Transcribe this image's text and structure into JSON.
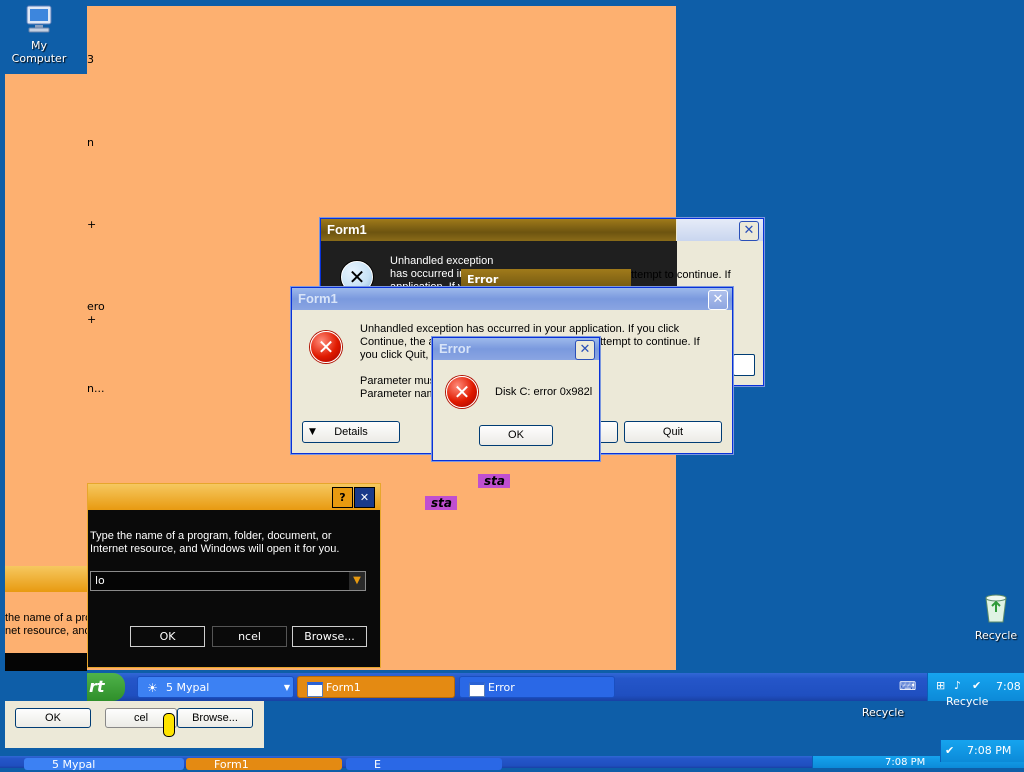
{
  "desktop": {
    "icons": [
      {
        "label": "My Computer",
        "icon": "my-computer-icon"
      },
      {
        "label": "Recycle",
        "icon": "recycle-bin-icon"
      },
      {
        "label": "Recycle",
        "icon": "recycle-bin-icon"
      }
    ],
    "ghost_fragments": [
      "3",
      "n",
      "+",
      "ero",
      "+",
      "n...",
      "sta",
      "sta",
      "Recycle"
    ]
  },
  "form1_back": {
    "title": "Form1",
    "message": "Unhandled exception has occurred in your application. If you click Continue, the a",
    "message_tail": "ttempt to continue. If",
    "inner_title": "Error"
  },
  "form1_front": {
    "title": "Form1",
    "message_line1": "Unhandled exception has occurred in your application. If you click",
    "message_line2a": "Continue, the a",
    "message_line2b": "ttempt to continue. If",
    "message_line3": "you click Quit, t",
    "param_line1": "Parameter must",
    "param_line2": "Parameter nam",
    "details_button": "Details",
    "quit_button": "Quit"
  },
  "error_dialog": {
    "title": "Error",
    "message": "Disk C: error 0x982l",
    "ok_button": "OK"
  },
  "run_dialog": {
    "help_glyph": "?",
    "close_glyph": "✕",
    "prompt_line1": "Type the name of a program, folder, document, or",
    "prompt_line2": "Internet resource, and Windows will open it for you.",
    "input_value": "lo",
    "ok_button": "OK",
    "cancel_button": "ncel",
    "browse_button": "Browse..."
  },
  "run_dialog_ghost": {
    "prompt_line1": "the name of a pro",
    "prompt_line2": "net resource, and",
    "ok_button": "OK",
    "cancel_button": "cel",
    "browse_button": "Browse..."
  },
  "taskbar_main": {
    "start_label": "rt",
    "buttons": [
      {
        "label": "5 Mypal",
        "icon": "mypal-icon"
      },
      {
        "label": "Form1",
        "icon": "window-icon"
      },
      {
        "label": "Error",
        "icon": "window-icon"
      }
    ],
    "clock": "7:08"
  },
  "taskbar_ghost": {
    "buttons": [
      "5 Mypal",
      "Form1",
      "E"
    ],
    "clock": "7:08 PM",
    "clock_corner": "7:08 PM"
  },
  "colors": {
    "desktop": "#0e5ea8",
    "ghost_orange": "#fdb070",
    "run_accent": "#e89a10",
    "xp_blue": "#0a54d6"
  }
}
